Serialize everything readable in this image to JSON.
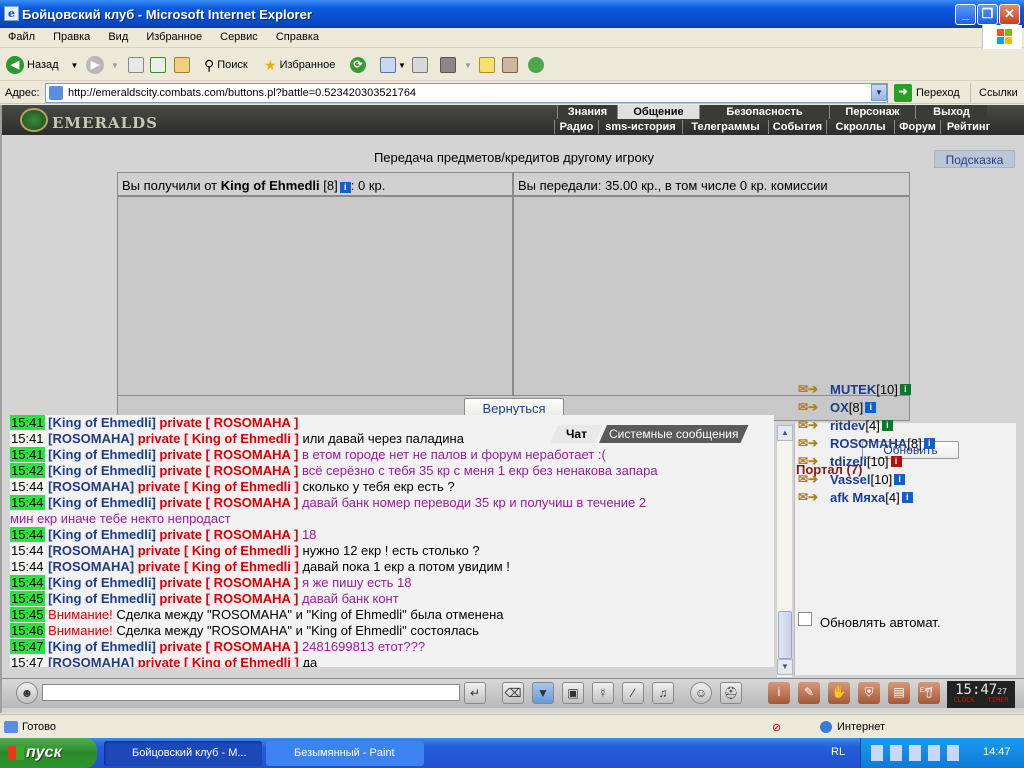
{
  "window": {
    "title": "Бойцовский клуб - Microsoft Internet Explorer",
    "app_icon": "ie-icon"
  },
  "menu": [
    "Файл",
    "Правка",
    "Вид",
    "Избранное",
    "Сервис",
    "Справка"
  ],
  "toolbar": {
    "back": "Назад",
    "search": "Поиск",
    "favorites": "Избранное"
  },
  "address": {
    "label": "Адрес:",
    "url": "http://emeraldscity.combats.com/buttons.pl?battle=0.523420303521764",
    "go": "Переход",
    "links": "Ссылки"
  },
  "site": {
    "logo": "EMERALDS",
    "nav_top": [
      "Знания",
      "Общение",
      "Безопасность",
      "Персонаж",
      "Выход"
    ],
    "nav_bottom": [
      "Радио",
      "sms-история",
      "Телеграммы",
      "События",
      "Скроллы",
      "Форум",
      "Рейтинг"
    ],
    "title": "Передача предметов/кредитов другому игроку",
    "help": "Подсказка",
    "received": {
      "prefix": "Вы получили от",
      "name": "King of Ehmedli",
      "level": "[8]",
      "amount": ": 0 кр."
    },
    "given": "Вы передали: 35.00 кр., в том числе 0 кр. комиссии",
    "back_button": "Вернуться"
  },
  "chat": {
    "tabs": [
      "Чат",
      "Системные сообщения"
    ],
    "lines": [
      {
        "time": "15:41",
        "hl": true,
        "name": "[King of Ehmedli]",
        "priv": "private [ ROSOMAHA ]",
        "text": "",
        "private_to_me": true
      },
      {
        "time": "15:41",
        "hl": false,
        "name": "[ROSOMAHA]",
        "priv": "private [ King of Ehmedli ]",
        "text": "или давай через паладина",
        "private_to_me": false
      },
      {
        "time": "15:41",
        "hl": true,
        "name": "[King of Ehmedli]",
        "priv": "private [ ROSOMAHA ]",
        "text": "в етом городе нет не палов и форум неработает :(",
        "private_to_me": true
      },
      {
        "time": "15:42",
        "hl": true,
        "name": "[King of Ehmedli]",
        "priv": "private [ ROSOMAHA ]",
        "text": "всё серёзно с тебя 35 кр с меня 1 екр без ненакова запара",
        "private_to_me": true
      },
      {
        "time": "15:44",
        "hl": false,
        "name": "[ROSOMAHA]",
        "priv": "private [ King of Ehmedli ]",
        "text": "сколько у тебя екр есть ?",
        "private_to_me": false
      },
      {
        "time": "15:44",
        "hl": true,
        "name": "[King of Ehmedli]",
        "priv": "private [ ROSOMAHA ]",
        "text": "давай банк номер переводи 35 кр и получиш в течение 2",
        "private_to_me": true
      },
      {
        "time": "",
        "hl": false,
        "name": "",
        "priv": "",
        "text": "мин екр иначе тебе некто непродаст",
        "private_to_me": true,
        "cont": true
      },
      {
        "time": "15:44",
        "hl": true,
        "name": "[King of Ehmedli]",
        "priv": "private [ ROSOMAHA ]",
        "text": "18",
        "private_to_me": true
      },
      {
        "time": "15:44",
        "hl": false,
        "name": "[ROSOMAHA]",
        "priv": "private [ King of Ehmedli ]",
        "text": "нужно 12 екр ! есть столько ?",
        "private_to_me": false
      },
      {
        "time": "15:44",
        "hl": false,
        "name": "[ROSOMAHA]",
        "priv": "private [ King of Ehmedli ]",
        "text": "давай пока 1 екр а потом увидим !",
        "private_to_me": false
      },
      {
        "time": "15:44",
        "hl": true,
        "name": "[King of Ehmedli]",
        "priv": "private [ ROSOMAHA ]",
        "text": "я же пишу есть 18",
        "private_to_me": true
      },
      {
        "time": "15:45",
        "hl": true,
        "name": "[King of Ehmedli]",
        "priv": "private [ ROSOMAHA ]",
        "text": "давай банк конт",
        "private_to_me": true
      },
      {
        "time": "15:45",
        "hl": true,
        "warn": "Внимание!",
        "text": "Сделка между \"ROSOMAHA\" и \"King of Ehmedli\" была отменена"
      },
      {
        "time": "15:46",
        "hl": true,
        "warn": "Внимание!",
        "text": "Сделка между \"ROSOMAHA\" и \"King of Ehmedli\" состоялась"
      },
      {
        "time": "15:47",
        "hl": true,
        "name": "[King of Ehmedli]",
        "priv": "private [ ROSOMAHA ]",
        "text": "2481699813 етот???",
        "private_to_me": true
      },
      {
        "time": "15:47",
        "hl": false,
        "name": "[ROSOMAHA]",
        "priv": "private [ King of Ehmedli ]",
        "text": "да",
        "private_to_me": false
      }
    ]
  },
  "sidebar": {
    "refresh": "Обновить",
    "room": "Портал (7)",
    "users": [
      {
        "name": "MUTEK",
        "level": "[10]",
        "badge": "g"
      },
      {
        "name": "OX",
        "level": "[8]",
        "badge": "b"
      },
      {
        "name": "ritdev",
        "level": "[4]",
        "badge": "g"
      },
      {
        "name": "ROSOMAHA",
        "level": "[8]",
        "badge": "b"
      },
      {
        "name": "tdizeli",
        "level": "[10]",
        "badge": "r"
      },
      {
        "name": "Vassel",
        "level": "[10]",
        "badge": "b"
      },
      {
        "name": "afk Мяха",
        "level": "[4]",
        "badge": "b"
      }
    ],
    "auto_refresh": "Обновлять автомат."
  },
  "clock": {
    "time": "15:47",
    "sec": "27",
    "clock_label": "CLOCK",
    "timer_label": "TIMER",
    "exit": "EXIT"
  },
  "status": {
    "text": "Готово",
    "zone": "Интернет"
  },
  "taskbar": {
    "start": "пуск",
    "tasks": [
      "Бойцовский клуб - М...",
      "Безымянный - Paint"
    ],
    "lang": "RL",
    "time": "14:47"
  }
}
